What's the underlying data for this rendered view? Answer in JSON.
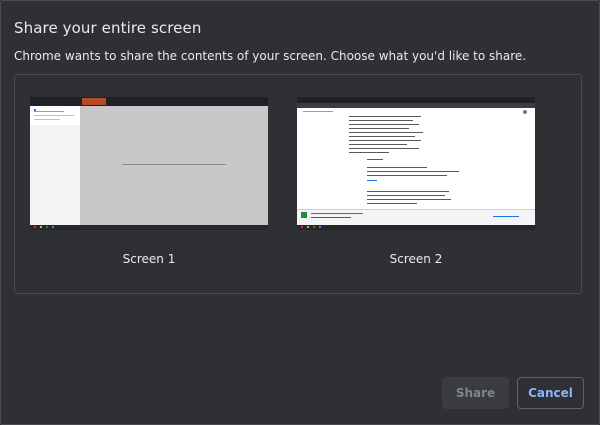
{
  "dialog": {
    "title": "Share your entire screen",
    "subtitle": "Chrome wants to share the contents of your screen. Choose what you'd like to share."
  },
  "screens": [
    {
      "label": "Screen 1"
    },
    {
      "label": "Screen 2"
    }
  ],
  "buttons": {
    "share_label": "Share",
    "share_enabled": false,
    "cancel_label": "Cancel"
  },
  "colors": {
    "background": "#2f3034",
    "accent": "#8ab4f8",
    "text": "#e8eaed",
    "disabled": "#80868b"
  }
}
